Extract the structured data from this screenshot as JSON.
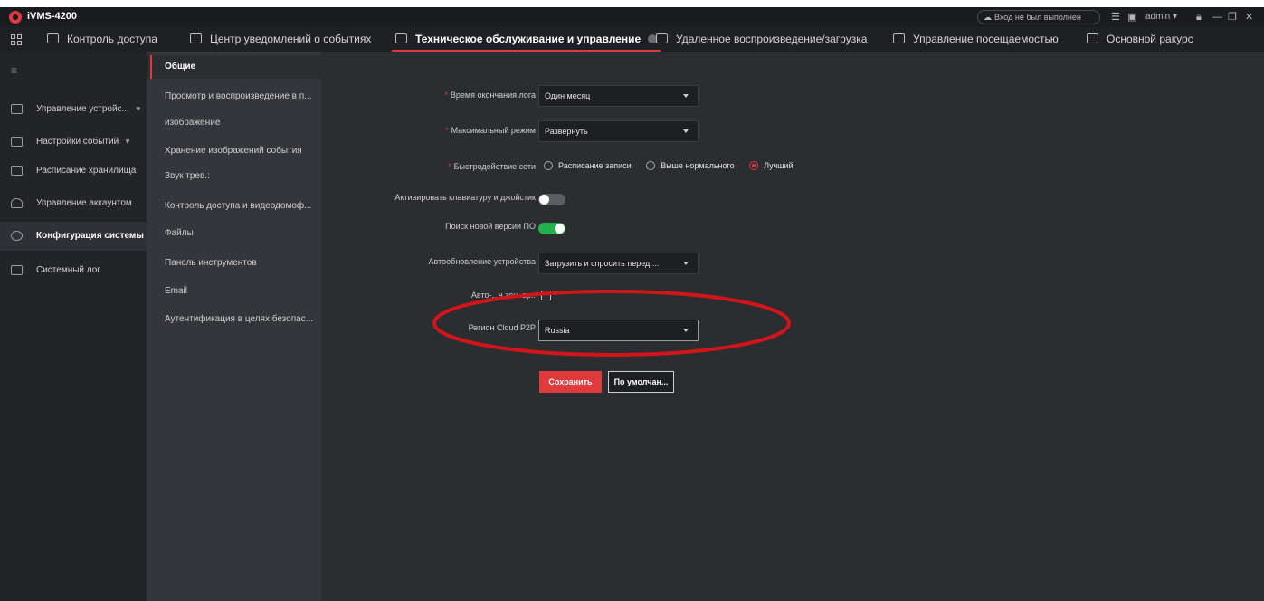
{
  "app": {
    "title": "iVMS-4200",
    "login_status": "Вход не был выполнен",
    "user": "admin"
  },
  "tabs": [
    {
      "label": "Контроль доступа"
    },
    {
      "label": "Центр уведомлений о событиях"
    },
    {
      "label": "Техническое обслуживание и управление",
      "active": true
    },
    {
      "label": "Удаленное воспроизведение/загрузка"
    },
    {
      "label": "Управление посещаемостью"
    },
    {
      "label": "Основной ракурс"
    }
  ],
  "leftnav": {
    "items": [
      {
        "label": "Управление устройс..."
      },
      {
        "label": "Настройки событий"
      },
      {
        "label": "Расписание хранилища"
      },
      {
        "label": "Управление аккаунтом"
      },
      {
        "label": "Конфигурация системы",
        "active": true
      },
      {
        "label": "Системный лог"
      }
    ]
  },
  "submenu": {
    "items": [
      {
        "label": "Общие",
        "active": true
      },
      {
        "label": "Просмотр и воспроизведение в п..."
      },
      {
        "label": "изображение"
      },
      {
        "label": "Хранение изображений события"
      },
      {
        "label": "Звук трев.:"
      },
      {
        "label": "Контроль доступа и видеодомоф..."
      },
      {
        "label": "Файлы"
      },
      {
        "label": "Панель инструментов"
      },
      {
        "label": "Email"
      },
      {
        "label": "Аутентификация в целях безопас..."
      }
    ]
  },
  "form": {
    "log_expiry": {
      "label": "Время окончания лога",
      "value": "Один месяц"
    },
    "max_mode": {
      "label": "Максимальный режим",
      "value": "Развернуть"
    },
    "network": {
      "label": "Быстродействие сети",
      "options": [
        "Расписание записи",
        "Выше нормального",
        "Лучший"
      ],
      "selected": "Лучший"
    },
    "keyboard": {
      "label": "Активировать клавиатуру и джойстик",
      "on": false
    },
    "firmware": {
      "label": "Поиск новой версии ПО",
      "on": true
    },
    "autoupdate": {
      "label": "Автообновление устройства",
      "value": "Загрузить и спросить перед ..."
    },
    "autotime": {
      "label": "Авто-...ч.зон. вр.:",
      "checked": false
    },
    "p2p_region": {
      "label": "Регион Cloud P2P",
      "value": "Russia"
    },
    "save_label": "Сохранить",
    "default_label": "По умолчан..."
  },
  "colors": {
    "accent": "#e0393e",
    "toggle_on": "#22b14c",
    "annotation": "#d0151b"
  }
}
